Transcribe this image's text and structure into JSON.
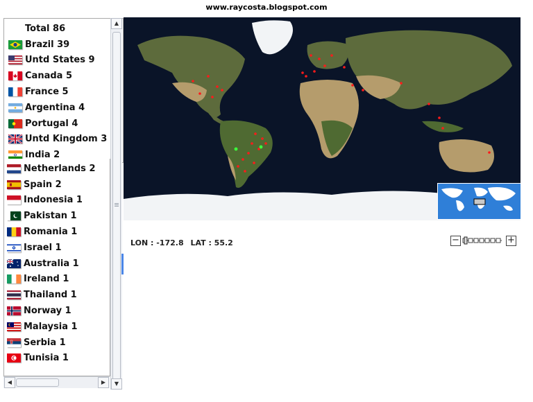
{
  "header": {
    "site": "www.raycosta.blogspot.com"
  },
  "countries_top": [
    {
      "label": "Total 86",
      "flag": "none"
    },
    {
      "label": "Brazil 39",
      "flag": "brazil"
    },
    {
      "label": "Untd States 9",
      "flag": "usa"
    },
    {
      "label": "Canada 5",
      "flag": "canada"
    },
    {
      "label": "France 5",
      "flag": "france"
    },
    {
      "label": "Argentina 4",
      "flag": "argentina"
    },
    {
      "label": "Portugal 4",
      "flag": "portugal"
    },
    {
      "label": "Untd Kingdom 3",
      "flag": "uk"
    },
    {
      "label": "India 2",
      "flag": "india"
    }
  ],
  "countries_bottom": [
    {
      "label": "Netherlands 2",
      "flag": "netherlands"
    },
    {
      "label": "Spain 2",
      "flag": "spain"
    },
    {
      "label": "Indonesia 1",
      "flag": "indonesia"
    },
    {
      "label": "Pakistan 1",
      "flag": "pakistan"
    },
    {
      "label": "Romania 1",
      "flag": "romania"
    },
    {
      "label": "Israel 1",
      "flag": "israel"
    },
    {
      "label": "Australia 1",
      "flag": "australia"
    },
    {
      "label": "Ireland 1",
      "flag": "ireland"
    },
    {
      "label": "Thailand 1",
      "flag": "thailand"
    },
    {
      "label": "Norway 1",
      "flag": "norway"
    },
    {
      "label": "Malaysia 1",
      "flag": "malaysia"
    },
    {
      "label": "Serbia 1",
      "flag": "serbia"
    },
    {
      "label": "Tunisia 1",
      "flag": "tunisia"
    }
  ],
  "status": {
    "lon": "LON : -172.8",
    "lat": "LAT : 55.2"
  },
  "colors": {
    "ocean": "#0a1428",
    "land": "#5d6b3c",
    "desert": "#b59c6c",
    "ice": "#f2f4f6",
    "visitor_dot": "#ff1a1a",
    "highlight_dot": "#3cff3c",
    "minimap_ocean": "#2f7fd8"
  }
}
